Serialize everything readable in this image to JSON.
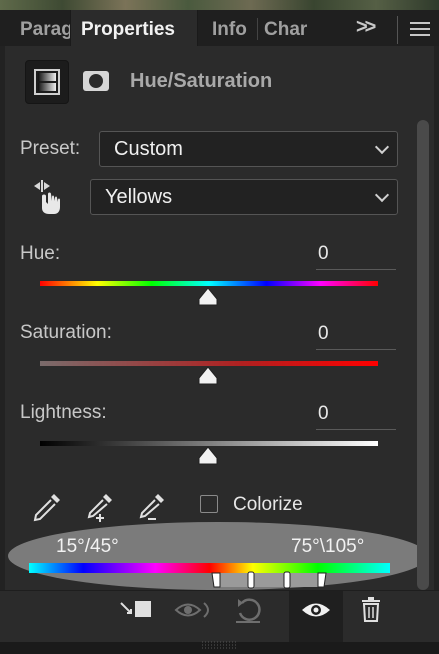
{
  "tabs": [
    {
      "label": "Parag",
      "active": false
    },
    {
      "label": "Properties",
      "active": true
    },
    {
      "label": "Info",
      "active": false
    },
    {
      "label": "Char",
      "active": false
    }
  ],
  "tab_overflow_label": ">>",
  "header": {
    "title": "Hue/Saturation"
  },
  "preset": {
    "label": "Preset:",
    "value": "Custom"
  },
  "channel": {
    "value": "Yellows"
  },
  "hue": {
    "label": "Hue:",
    "value": "0",
    "level": 0
  },
  "saturation": {
    "label": "Saturation:",
    "value": "0",
    "level": 0
  },
  "lightness": {
    "label": "Lightness:",
    "value": "0",
    "level": 0
  },
  "colorize": {
    "label": "Colorize",
    "checked": false
  },
  "range": {
    "left": "15°/45°",
    "right": "75°\\105°"
  },
  "icons": {
    "header": [
      "adjustment-layer-icon",
      "layer-mask-icon"
    ],
    "eyedroppers": [
      "eyedropper-icon",
      "eyedropper-add-icon",
      "eyedropper-subtract-icon"
    ],
    "bottom": [
      "clip-to-layer-icon",
      "view-previous-state-icon",
      "reset-icon",
      "visibility-eye-icon",
      "trash-icon"
    ]
  },
  "colors": {
    "panel": "#2b2b2b",
    "tabbar": "#1f1f1f",
    "text": "#d6d6d6",
    "highlight": "#bebebe"
  }
}
